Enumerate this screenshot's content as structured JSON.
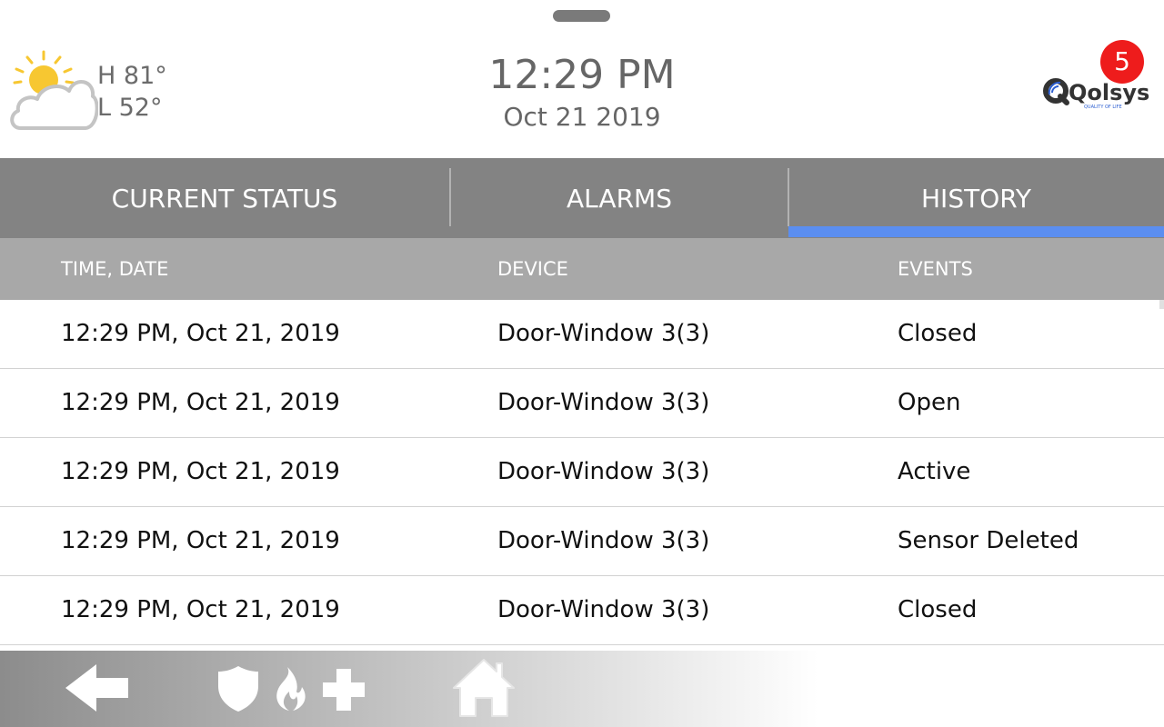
{
  "weather": {
    "icon": "partly-cloudy-icon",
    "high": "H 81°",
    "low": "L 52°"
  },
  "clock": {
    "time": "12:29 PM",
    "date": "Oct 21 2019"
  },
  "brand": {
    "logo_text": "Qolsys",
    "tagline": "QUALITY OF LIFE"
  },
  "notifications": {
    "count": "5"
  },
  "tabs": [
    {
      "label": "CURRENT STATUS"
    },
    {
      "label": "ALARMS"
    },
    {
      "label": "HISTORY"
    }
  ],
  "active_tab": "HISTORY",
  "table": {
    "columns": [
      "TIME, DATE",
      "DEVICE",
      "EVENTS"
    ],
    "rows": [
      {
        "time": "12:29 PM, Oct 21, 2019",
        "device": "Door-Window 3(3)",
        "event": "Closed"
      },
      {
        "time": "12:29 PM, Oct 21, 2019",
        "device": "Door-Window 3(3)",
        "event": "Open"
      },
      {
        "time": "12:29 PM, Oct 21, 2019",
        "device": "Door-Window 3(3)",
        "event": "Active"
      },
      {
        "time": "12:29 PM, Oct 21, 2019",
        "device": "Door-Window 3(3)",
        "event": "Sensor Deleted"
      },
      {
        "time": "12:29 PM, Oct 21, 2019",
        "device": "Door-Window 3(3)",
        "event": "Closed"
      }
    ]
  },
  "bottom_bar": {
    "icons": [
      "back-arrow-icon",
      "shield-icon",
      "fire-icon",
      "medical-cross-icon",
      "home-icon"
    ]
  },
  "colors": {
    "tab_bar": "#838383",
    "active_underline": "#5b8ef0",
    "badge": "#ee1c1c",
    "table_header": "#a8a8a8"
  }
}
